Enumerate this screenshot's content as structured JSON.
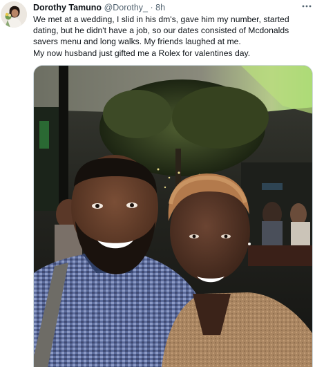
{
  "tweet": {
    "author": {
      "display_name": "Dorothy Tamuno",
      "handle": "@Dorothy_",
      "separator": "·",
      "time": "8h",
      "avatar_icon": "profile-photo"
    },
    "more_icon": "more-horizontal-icon",
    "text_lines": [
      "We met at a wedding, I slid in his dm's, gave him my number, started",
      "dating, but he didn't have a job, so our dates consisted of Mcdonalds",
      "savers menu and long walks. My friends laughed at me.",
      "My now husband just gifted me a Rolex for valentines day."
    ],
    "media": {
      "type": "photo"
    }
  },
  "colors": {
    "text_primary": "#0f1419",
    "text_secondary": "#536471",
    "border": "#cfd9de"
  }
}
